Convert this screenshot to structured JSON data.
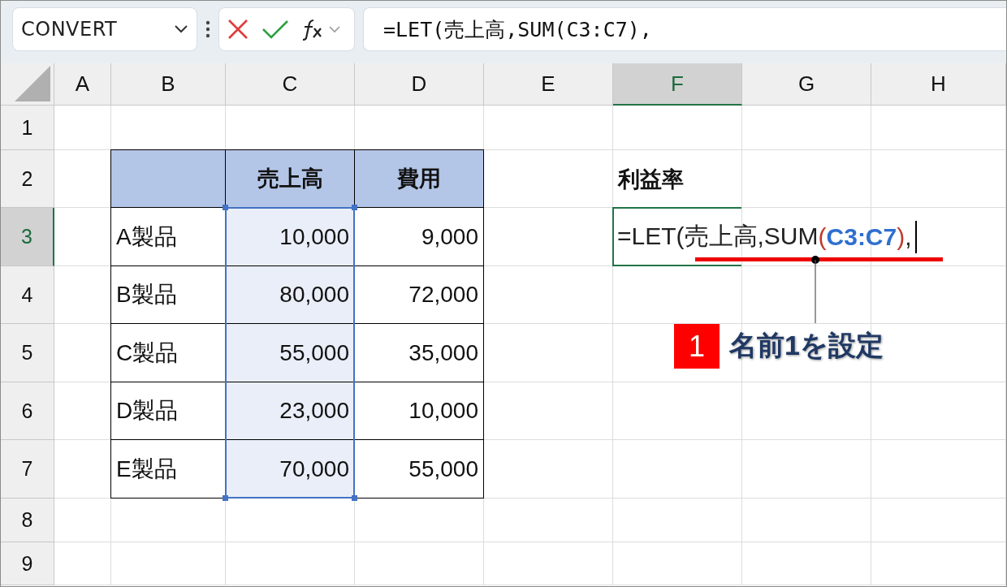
{
  "name_box": {
    "value": "CONVERT"
  },
  "formula_bar": {
    "value": "=LET(売上高,SUM(C3:C7),"
  },
  "columns": [
    {
      "label": "A",
      "selected": false
    },
    {
      "label": "B",
      "selected": false
    },
    {
      "label": "C",
      "selected": false
    },
    {
      "label": "D",
      "selected": false
    },
    {
      "label": "E",
      "selected": false
    },
    {
      "label": "F",
      "selected": true
    },
    {
      "label": "G",
      "selected": false
    },
    {
      "label": "H",
      "selected": false
    }
  ],
  "rows": [
    {
      "label": "1",
      "selected": false
    },
    {
      "label": "2",
      "selected": false
    },
    {
      "label": "3",
      "selected": true
    },
    {
      "label": "4",
      "selected": false
    },
    {
      "label": "5",
      "selected": false
    },
    {
      "label": "6",
      "selected": false
    },
    {
      "label": "7",
      "selected": false
    },
    {
      "label": "8",
      "selected": false
    },
    {
      "label": "9",
      "selected": false
    }
  ],
  "table": {
    "columns": [
      {
        "label": "売上高",
        "range_selected": true
      },
      {
        "label": "費用",
        "range_selected": false
      }
    ],
    "rows": [
      {
        "label": "A製品",
        "values": [
          "10,000",
          "9,000"
        ]
      },
      {
        "label": "B製品",
        "values": [
          "80,000",
          "72,000"
        ]
      },
      {
        "label": "C製品",
        "values": [
          "55,000",
          "35,000"
        ]
      },
      {
        "label": "D製品",
        "values": [
          "23,000",
          "10,000"
        ]
      },
      {
        "label": "E製品",
        "values": [
          "70,000",
          "55,000"
        ]
      }
    ]
  },
  "label_cell": "利益率",
  "editing_cell": {
    "segments": [
      {
        "kind": "plain",
        "text": "=LET(売上高,SUM"
      },
      {
        "kind": "paren",
        "text": "("
      },
      {
        "kind": "ref",
        "text": "C3:C7"
      },
      {
        "kind": "paren",
        "text": ")"
      },
      {
        "kind": "plain",
        "text": ","
      }
    ]
  },
  "callout": {
    "number": "1",
    "text": "名前1を設定"
  }
}
